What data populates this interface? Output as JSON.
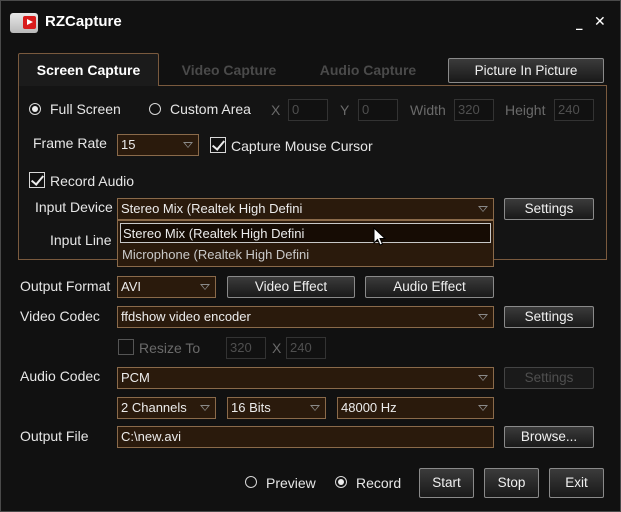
{
  "title": "RZCapture",
  "tabs": [
    "Screen Capture",
    "Video Capture",
    "Audio Capture"
  ],
  "pip_button": "Picture In Picture",
  "capture": {
    "full_screen": "Full Screen",
    "custom_area": "Custom Area",
    "x_label": "X",
    "x_value": "0",
    "y_label": "Y",
    "y_value": "0",
    "width_label": "Width",
    "width_value": "320",
    "height_label": "Height",
    "height_value": "240"
  },
  "frame_rate": {
    "label": "Frame Rate",
    "value": "15"
  },
  "mouse_cursor": {
    "label": "Capture Mouse Cursor",
    "checked": true
  },
  "record_audio": {
    "label": "Record Audio",
    "checked": true
  },
  "input_device": {
    "label": "Input Device",
    "value": "Stereo Mix (Realtek High Defini",
    "settings": "Settings",
    "options": [
      "Stereo Mix (Realtek High Defini",
      "Microphone (Realtek High Defini"
    ]
  },
  "input_line": {
    "label": "Input Line"
  },
  "output_format": {
    "label": "Output Format",
    "value": "AVI",
    "video_effect": "Video Effect",
    "audio_effect": "Audio Effect"
  },
  "video_codec": {
    "label": "Video Codec",
    "value": "ffdshow video encoder",
    "settings": "Settings"
  },
  "resize": {
    "label": "Resize To",
    "width": "320",
    "x": "X",
    "height": "240"
  },
  "audio_codec": {
    "label": "Audio Codec",
    "value": "PCM",
    "settings": "Settings",
    "channels": "2 Channels",
    "bits": "16 Bits",
    "rate": "48000 Hz"
  },
  "output_file": {
    "label": "Output File",
    "value": "C:\\new.avi",
    "browse": "Browse..."
  },
  "bottom": {
    "preview": "Preview",
    "record": "Record",
    "start": "Start",
    "stop": "Stop",
    "exit": "Exit"
  }
}
